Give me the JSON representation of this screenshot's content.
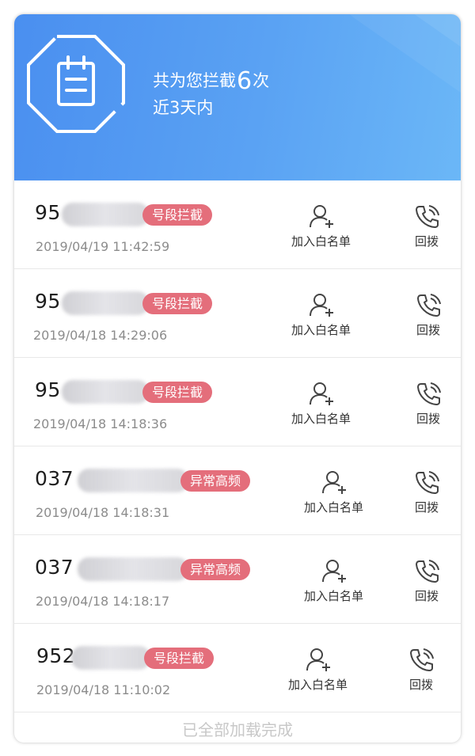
{
  "summary": {
    "prefix": "共为您拦截",
    "count": "6",
    "suffix": "次",
    "range": "近3天内"
  },
  "colors": {
    "header_start": "#4a8ff0",
    "header_end": "#6bb7f7",
    "tag": "#e46e7b"
  },
  "calls": [
    {
      "number": "95",
      "tag": "号段拦截",
      "time": "2019/04/19 11:42:59",
      "whitelist_label": "加入白名单",
      "redial_label": "回拨"
    },
    {
      "number": "95",
      "tag": "号段拦截",
      "time": "2019/04/18 14:29:06",
      "whitelist_label": "加入白名单",
      "redial_label": "回拨"
    },
    {
      "number": "95",
      "tag": "号段拦截",
      "time": "2019/04/18 14:18:36",
      "whitelist_label": "加入白名单",
      "redial_label": "回拨"
    },
    {
      "number": "037",
      "tag": "异常高频",
      "time": "2019/04/18 14:18:31",
      "whitelist_label": "加入白名单",
      "redial_label": "回拨"
    },
    {
      "number": "037",
      "tag": "异常高频",
      "time": "2019/04/18 14:18:17",
      "whitelist_label": "加入白名单",
      "redial_label": "回拨"
    },
    {
      "number": "952",
      "tag": "号段拦截",
      "time": "2019/04/18 11:10:02",
      "whitelist_label": "加入白名单",
      "redial_label": "回拨"
    }
  ],
  "footer": {
    "text": "已全部加载完成"
  }
}
